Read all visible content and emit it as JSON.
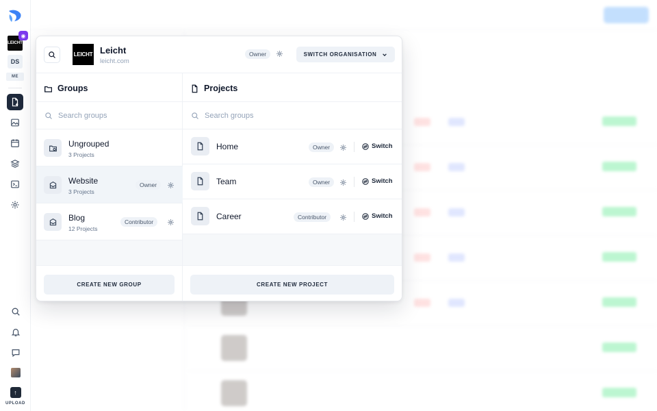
{
  "rail": {
    "org_tile_label": "LEICHT",
    "ds_label": "DS",
    "me_label": "ME",
    "upload_label": "UPLOAD"
  },
  "header": {
    "org_logo_text": "LEICHT",
    "org_name": "Leicht",
    "org_url": "leicht.com",
    "role": "Owner",
    "switch_label": "SWITCH ORGANISATION"
  },
  "groups": {
    "title": "Groups",
    "search_placeholder": "Search groups",
    "items": [
      {
        "name": "Ungrouped",
        "count": "3 Projects",
        "role": ""
      },
      {
        "name": "Website",
        "count": "3 Projects",
        "role": "Owner"
      },
      {
        "name": "Blog",
        "count": "12 Projects",
        "role": "Contributor"
      }
    ],
    "create_label": "CREATE NEW GROUP"
  },
  "projects": {
    "title": "Projects",
    "search_placeholder": "Search groups",
    "switch_label": "Switch",
    "items": [
      {
        "name": "Home",
        "role": "Owner"
      },
      {
        "name": "Team",
        "role": "Owner"
      },
      {
        "name": "Career",
        "role": "Contributor"
      }
    ],
    "create_label": "CREATE NEW PROJECT"
  },
  "colors": {
    "accent": "#0f172a",
    "rail_active": "#1e293b",
    "badge": "#7c3aed",
    "status_green": "#86efac",
    "primary_blue": "#93c5fd"
  }
}
